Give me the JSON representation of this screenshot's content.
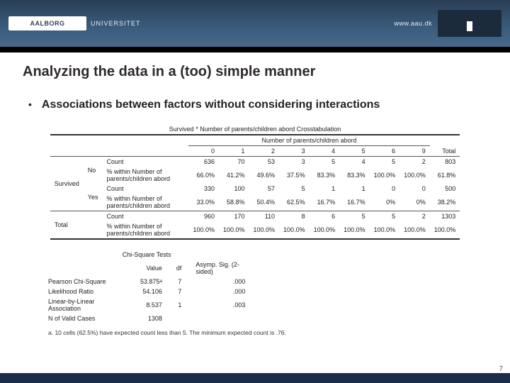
{
  "banner": {
    "logo_text": "AALBORG",
    "logo_suffix": "UNIVERSITET",
    "url": "www.aau.dk"
  },
  "title": "Analyzing the data in a (too) simple manner",
  "bullet": "Associations between factors without considering interactions",
  "crosstab": {
    "caption": "Survived * Number of parents/children abord Crosstabulation",
    "group_header": "Number of parents/children abord",
    "cols": [
      "0",
      "1",
      "2",
      "3",
      "4",
      "5",
      "6",
      "9",
      "Total"
    ],
    "row_group": "Survived",
    "rows": [
      {
        "cat": "No",
        "measure1": "Count",
        "v1": [
          "636",
          "70",
          "53",
          "3",
          "5",
          "4",
          "5",
          "2",
          "803"
        ],
        "measure2": "% within Number of parents/children abord",
        "v2": [
          "66.0%",
          "41.2%",
          "49.6%",
          "37.5%",
          "83.3%",
          "83.3%",
          "100.0%",
          "100.0%",
          "61.8%"
        ]
      },
      {
        "cat": "Yes",
        "measure1": "Count",
        "v1": [
          "330",
          "100",
          "57",
          "5",
          "1",
          "1",
          "0",
          "0",
          "500"
        ],
        "measure2": "% within Number of parents/children abord",
        "v2": [
          "33.0%",
          "58.8%",
          "50.4%",
          "62.5%",
          "16.7%",
          "16.7%",
          "0%",
          "0%",
          "38.2%"
        ]
      }
    ],
    "total": {
      "label": "Total",
      "measure1": "Count",
      "v1": [
        "960",
        "170",
        "110",
        "8",
        "6",
        "5",
        "5",
        "2",
        "1303"
      ],
      "measure2": "% within Number of parents/children abord",
      "v2": [
        "100.0%",
        "100.0%",
        "100.0%",
        "100.0%",
        "100.0%",
        "100.0%",
        "100.0%",
        "100.0%",
        "100.0%"
      ]
    }
  },
  "chisq": {
    "caption": "Chi-Square Tests",
    "headers": [
      "",
      "Value",
      "df",
      "Asymp. Sig. (2-sided)"
    ],
    "rows": [
      [
        "Pearson Chi-Square",
        "53.875ᵃ",
        "7",
        ".000"
      ],
      [
        "Likelihood Ratio",
        "54.106",
        "7",
        ".000"
      ],
      [
        "Linear-by-Linear Association",
        "8.537",
        "1",
        ".003"
      ],
      [
        "N of Valid Cases",
        "1308",
        "",
        ""
      ]
    ],
    "footnote": "a. 10 cells (62.5%) have expected count less than 5. The minimum expected count is .76."
  },
  "page_number": "7"
}
